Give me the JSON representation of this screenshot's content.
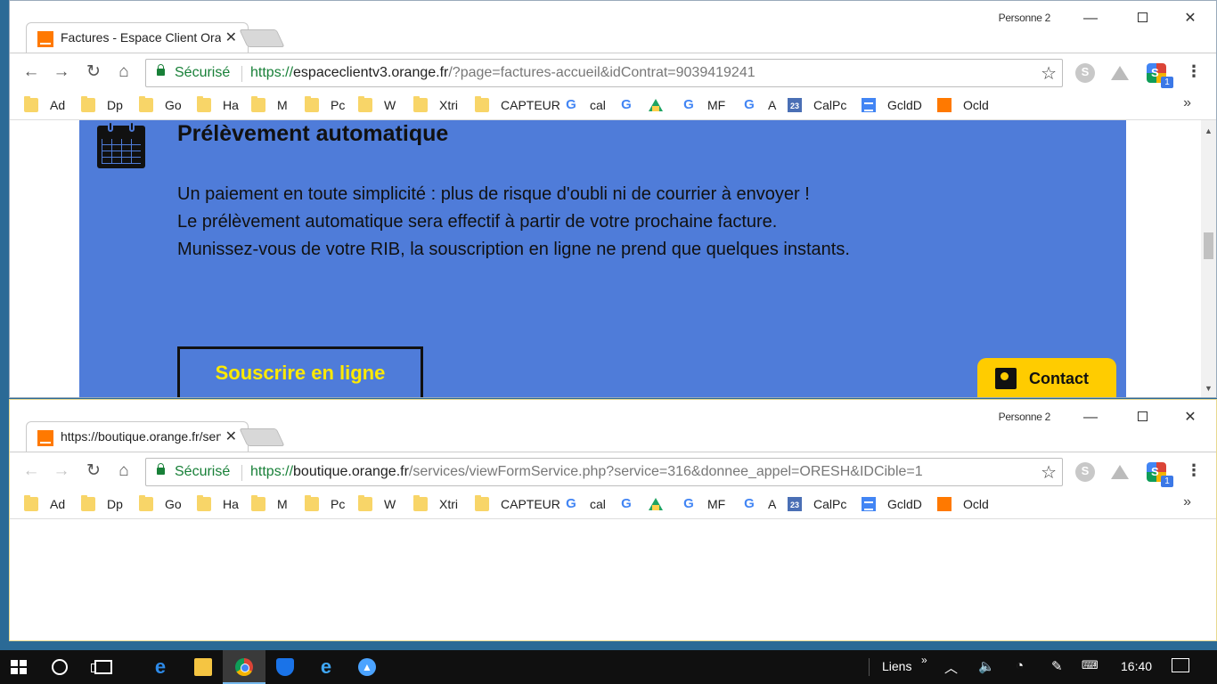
{
  "profile_name": "Personne 2",
  "bookmarks": [
    {
      "label": "Ad",
      "icon": "folder-icon"
    },
    {
      "label": "Dp",
      "icon": "folder-icon"
    },
    {
      "label": "Go",
      "icon": "folder-icon"
    },
    {
      "label": "Ha",
      "icon": "folder-icon"
    },
    {
      "label": "M",
      "icon": "folder-icon"
    },
    {
      "label": "Pc",
      "icon": "folder-icon"
    },
    {
      "label": "W",
      "icon": "folder-icon"
    },
    {
      "label": "Xtri",
      "icon": "folder-icon"
    },
    {
      "label": "CAPTEUR",
      "icon": "folder-icon"
    },
    {
      "label": "cal",
      "icon": "google-icon"
    },
    {
      "label": "",
      "icon": "google-icon"
    },
    {
      "label": "",
      "icon": "drive-icon"
    },
    {
      "label": "MF",
      "icon": "google-icon"
    },
    {
      "label": "A",
      "icon": "google-icon"
    },
    {
      "label": "CalPc",
      "icon": "calendar-icon",
      "icon_text": "23"
    },
    {
      "label": "GcldD",
      "icon": "docs-icon"
    },
    {
      "label": "Ocld",
      "icon": "orange-icon"
    }
  ],
  "window1": {
    "tab_title": "Factures - Espace Client Orange",
    "secure_label": "Sécurisé",
    "url_scheme": "https://",
    "url_host": "espaceclientv3.orange.fr",
    "url_rest": "/?page=factures-accueil&idContrat=9039419241",
    "content": {
      "title": "Prélèvement automatique",
      "line1": "Un paiement en toute simplicité : plus de risque d'oubli ni de courrier à envoyer !",
      "line2": "Le prélèvement automatique sera effectif à partir de votre prochaine facture.",
      "line3": "Munissez-vous de votre RIB, la souscription en ligne ne prend que quelques instants.",
      "subscribe_button": "Souscrire en ligne",
      "contact_button": "Contact"
    }
  },
  "window2": {
    "tab_title": "https://boutique.orange.fr/services",
    "secure_label": "Sécurisé",
    "url_scheme": "https://",
    "url_host": "boutique.orange.fr",
    "url_rest": "/services/viewFormService.php?service=316&donnee_appel=ORESH&IDCible=1"
  },
  "taskbar": {
    "links_label": "Liens",
    "time": "16:40"
  },
  "colors": {
    "panel_blue": "#4f7cd9",
    "button_text_yellow": "#ffea00",
    "contact_yellow": "#ffcc00",
    "secure_green": "#188038",
    "orange_brand": "#ff7900"
  }
}
